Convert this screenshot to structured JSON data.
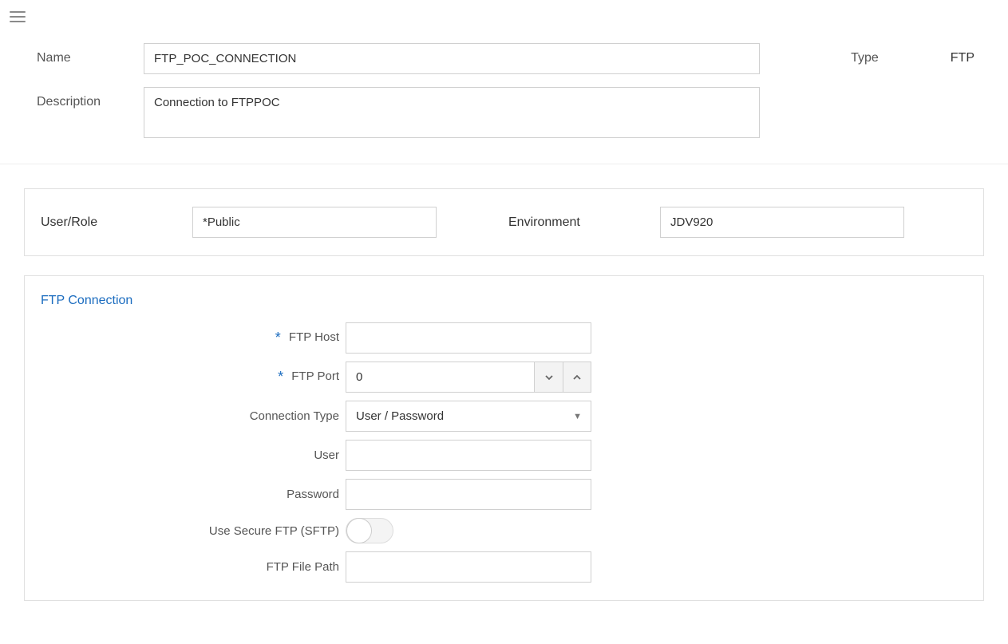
{
  "header": {
    "name_label": "Name",
    "name_value": "FTP_POC_CONNECTION",
    "description_label": "Description",
    "description_value": "Connection to FTPPOC",
    "type_label": "Type",
    "type_value": "FTP"
  },
  "scope": {
    "user_role_label": "User/Role",
    "user_role_value": "*Public",
    "environment_label": "Environment",
    "environment_value": "JDV920"
  },
  "ftp": {
    "section_title": "FTP Connection",
    "host_label": "FTP Host",
    "host_value": "",
    "port_label": "FTP Port",
    "port_value": "0",
    "conn_type_label": "Connection Type",
    "conn_type_value": "User / Password",
    "user_label": "User",
    "user_value": "",
    "password_label": "Password",
    "password_value": "",
    "sftp_label": "Use Secure FTP (SFTP)",
    "sftp_on": false,
    "file_path_label": "FTP File Path",
    "file_path_value": ""
  }
}
